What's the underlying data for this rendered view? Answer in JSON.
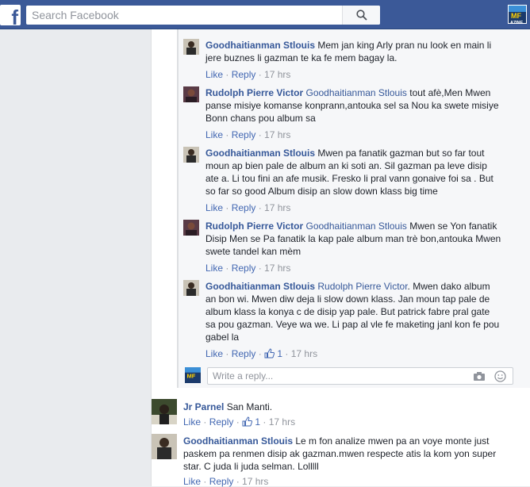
{
  "topbar": {
    "logo_letter": "f",
    "search_placeholder": "Search Facebook",
    "profile_thumb_label": "MF\nA7INE"
  },
  "replies": [
    {
      "author": "Goodhaitianman Stlouis",
      "mention": "",
      "lines": [
        "Mem jan king Arly pran nu look en main li",
        "jere buznes li gazman te ka fe mem bagay la."
      ],
      "likes": "",
      "time": "17 hrs"
    },
    {
      "author": "Rudolph Pierre Victor",
      "mention": "Goodhaitianman Stlouis",
      "lines": [
        "tout afè,Men Mwen",
        "panse misiye komanse konprann,antouka sel sa Nou ka swete misiye",
        "Bonn chans pou album sa"
      ],
      "likes": "",
      "time": "17 hrs"
    },
    {
      "author": "Goodhaitianman Stlouis",
      "mention": "",
      "lines": [
        "Mwen pa fanatik gazman but so far tout",
        "moun ap bien pale de album an ki soti an. Sil gazman pa leve disip",
        "ate a. Li tou fini an afe musik. Fresko li pral vann gonaive foi sa . But",
        "so far so good Album disip an slow down klass big time"
      ],
      "likes": "",
      "time": "17 hrs"
    },
    {
      "author": "Rudolph Pierre Victor",
      "mention": "Goodhaitianman Stlouis",
      "lines": [
        "Mwen se Yon fanatik",
        "Disip Men se Pa fanatik la kap pale album man trè bon,antouka Mwen",
        "swete tandel kan mèm"
      ],
      "likes": "",
      "time": "17 hrs"
    },
    {
      "author": "Goodhaitianman Stlouis",
      "mention": "Rudolph Pierre Victor",
      "lines": [
        ". Mwen dako album",
        "an bon wi. Mwen diw deja li slow down klass. Jan moun tap pale de",
        "album klass la konya c de disip yap pale. But patrick fabre pral gate",
        "sa pou gazman. Veye wa we. Li pap al vle fe maketing janl kon fe pou",
        "gabel la"
      ],
      "likes": "1",
      "time": "17 hrs"
    }
  ],
  "reply_box": {
    "placeholder": "Write a reply..."
  },
  "comments": [
    {
      "author": "Jr Parnel",
      "lines": [
        "San Manti."
      ],
      "likes": "1",
      "time": "17 hrs"
    },
    {
      "author": "Goodhaitianman Stlouis",
      "lines": [
        "Le m fon analize mwen pa an voye monte just",
        "paskem pa renmen disip ak gazman.mwen respecte atis la kom yon super",
        "star. C juda li juda selman. Lolllll"
      ],
      "likes": "",
      "time": "17 hrs"
    }
  ],
  "labels": {
    "like": "Like",
    "reply": "Reply",
    "sep": " · "
  },
  "colors": {
    "brand": "#3b5998",
    "link": "#365899",
    "action": "#4267b2",
    "muted": "#90949c"
  }
}
